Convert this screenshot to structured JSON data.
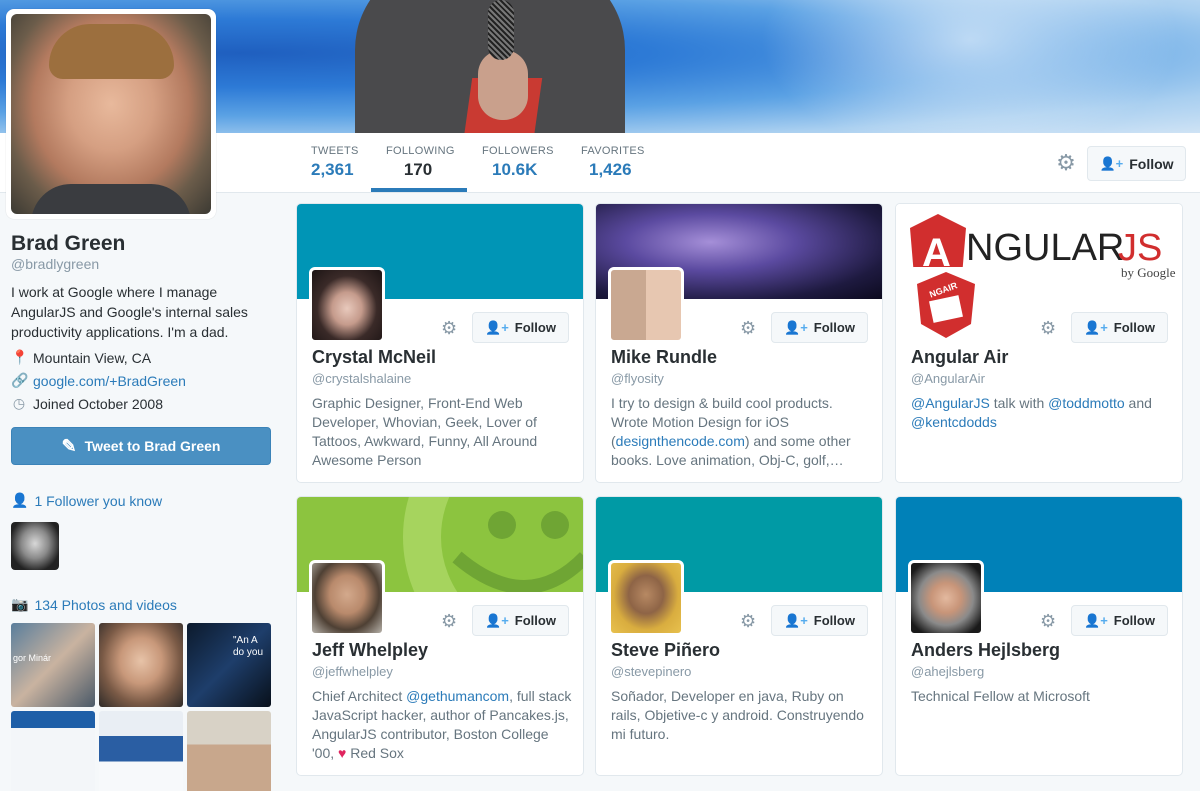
{
  "profile": {
    "name": "Brad Green",
    "handle": "@bradlygreen",
    "bio": "I work at Google where I manage AngularJS and Google's internal sales productivity applications. I'm a dad.",
    "location": "Mountain View, CA",
    "website": "google.com/+BradGreen",
    "joined": "Joined October 2008",
    "tweet_to_label": "Tweet to Brad Green",
    "followers_you_know": "1 Follower you know",
    "photos_videos": "134 Photos and videos"
  },
  "nav": {
    "stats": [
      {
        "label": "TWEETS",
        "value": "2,361"
      },
      {
        "label": "FOLLOWING",
        "value": "170"
      },
      {
        "label": "FOLLOWERS",
        "value": "10.6K"
      },
      {
        "label": "FAVORITES",
        "value": "1,426"
      }
    ],
    "active_stat": "FOLLOWING",
    "follow_label": "Follow"
  },
  "icons": {
    "gear": "gear-icon",
    "follow": "person-plus-icon",
    "location": "location-pin-icon",
    "link": "link-icon",
    "calendar": "calendar-icon",
    "feather": "feather-icon",
    "person": "person-icon",
    "camera": "camera-icon"
  },
  "colors": {
    "accent": "#2b7bb9",
    "header_teal": "#0095b6",
    "tweet_button": "#4a90c2",
    "heart": "#e0245e"
  },
  "cards": [
    {
      "name": "Crystal McNeil",
      "handle": "@crystalshalaine",
      "bio": "Graphic Designer, Front-End Web Developer, Whovian, Geek, Lover of Tattoos, Awkward, Funny, All Around Awesome Person",
      "follow_label": "Follow"
    },
    {
      "name": "Mike Rundle",
      "handle": "@flyosity",
      "bio_pre": "I try to design & build cool products. Wrote Motion Design for iOS (",
      "bio_link": "designthencode.com",
      "bio_post": ") and some other books. Love animation, Obj-C, golf,…",
      "follow_label": "Follow"
    },
    {
      "name": "Angular Air",
      "handle": "@AngularAir",
      "bio_link1": "@AngularJS",
      "bio_mid": " talk with ",
      "bio_link2": "@toddmotto",
      "bio_and": " and ",
      "bio_link3": "@kentcdodds",
      "logo_text": "NGULAR",
      "logo_js": "JS",
      "logo_a": "A",
      "logo_by": "by Google",
      "badge_text": "NGAIR",
      "follow_label": "Follow"
    },
    {
      "name": "Jeff Whelpley",
      "handle": "@jeffwhelpley",
      "bio_pre": "Chief Architect ",
      "bio_link": "@gethumancom",
      "bio_post": ", full stack JavaScript hacker, author of Pancakes.js, AngularJS contributor, Boston College '00, ",
      "bio_heart": "♥",
      "bio_end": " Red Sox",
      "follow_label": "Follow"
    },
    {
      "name": "Steve Piñero",
      "handle": "@stevepinero",
      "bio": "Soñador, Developer en java, Ruby on rails, Objetive-c y android. Construyendo mi futuro.",
      "follow_label": "Follow"
    },
    {
      "name": "Anders Hejlsberg",
      "handle": "@ahejlsberg",
      "bio": "Technical Fellow at Microsoft",
      "follow_label": "Follow"
    }
  ],
  "photo_captions": {
    "p1": "gor Minár",
    "p2a": "\"An A",
    "p2b": "do you"
  }
}
